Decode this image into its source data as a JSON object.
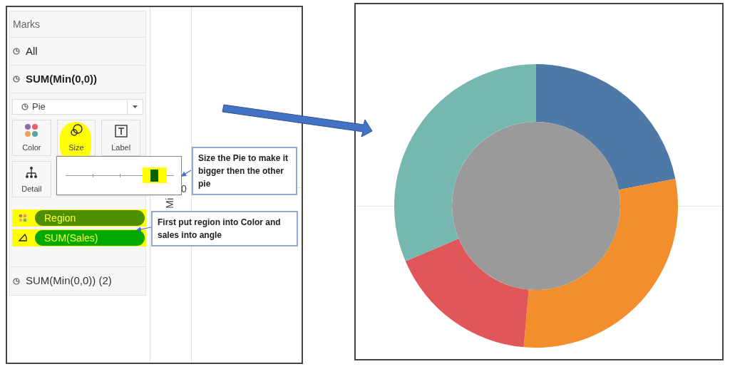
{
  "marks_panel": {
    "title": "Marks",
    "layers": [
      {
        "label": "All",
        "bold": false
      },
      {
        "label": "SUM(Min(0,0))",
        "bold": true
      }
    ],
    "mark_type": "Pie",
    "cards": [
      {
        "label": "Color",
        "kind": "color",
        "highlighted": false
      },
      {
        "label": "Size",
        "kind": "size",
        "highlighted": true
      },
      {
        "label": "Label",
        "kind": "label",
        "highlighted": false
      },
      {
        "label": "Detail",
        "kind": "detail",
        "highlighted": false
      }
    ],
    "pills": [
      {
        "label": "Region",
        "kind": "color",
        "color": "#4e8f00"
      },
      {
        "label": "SUM(Sales)",
        "kind": "angle",
        "color": "#00a800"
      }
    ],
    "second_layer": {
      "label": "SUM(Min(0,0)) (2)"
    }
  },
  "axis": {
    "label": "Mi",
    "tick": "0"
  },
  "callouts": [
    {
      "text": "Size the Pie to make it bigger then the other pie"
    },
    {
      "text": "First put region into Color and sales into angle"
    }
  ]
}
